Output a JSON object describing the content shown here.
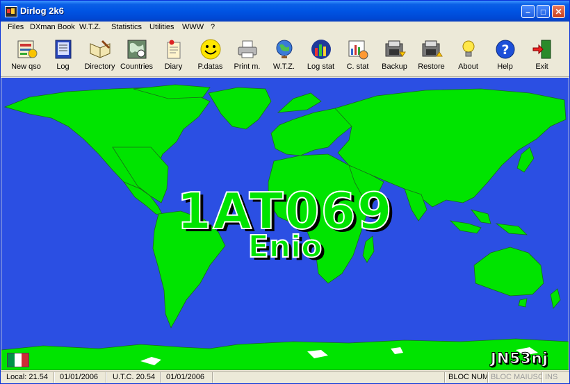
{
  "window": {
    "title": "Dirlog 2k6"
  },
  "menu": [
    "Files",
    "DXman Book",
    "W.T.Z.",
    "Statistics",
    "Utilities",
    "WWW",
    "?"
  ],
  "toolbar": {
    "new_qso": "New qso",
    "log": "Log",
    "directory": "Directory",
    "countries": "Countries",
    "diary": "Diary",
    "pdatas": "P.datas",
    "print": "Print m.",
    "wtz": "W.T.Z.",
    "log_stat": "Log stat",
    "c_stat": "C. stat",
    "backup": "Backup",
    "restore": "Restore",
    "about": "About",
    "help": "Help",
    "exit": "Exit"
  },
  "station": {
    "callsign": "1AT069",
    "operator": "Enio",
    "locator": "JN53nj",
    "flag": "italy-flag"
  },
  "status": {
    "local_time": "Local: 21.54",
    "local_date": "01/01/2006",
    "utc_time": "U.T.C. 20.54",
    "utc_date": "01/01/2006",
    "num_lock": "BLOC NUM",
    "caps_lock": "BLOC MAIUSC",
    "ins": "INS"
  },
  "colors": {
    "ocean": "#2b4fe3",
    "land": "#00e400",
    "titlebar": "#0054e3",
    "flag_green": "#009246",
    "flag_white": "#ffffff",
    "flag_red": "#ce2b37"
  }
}
